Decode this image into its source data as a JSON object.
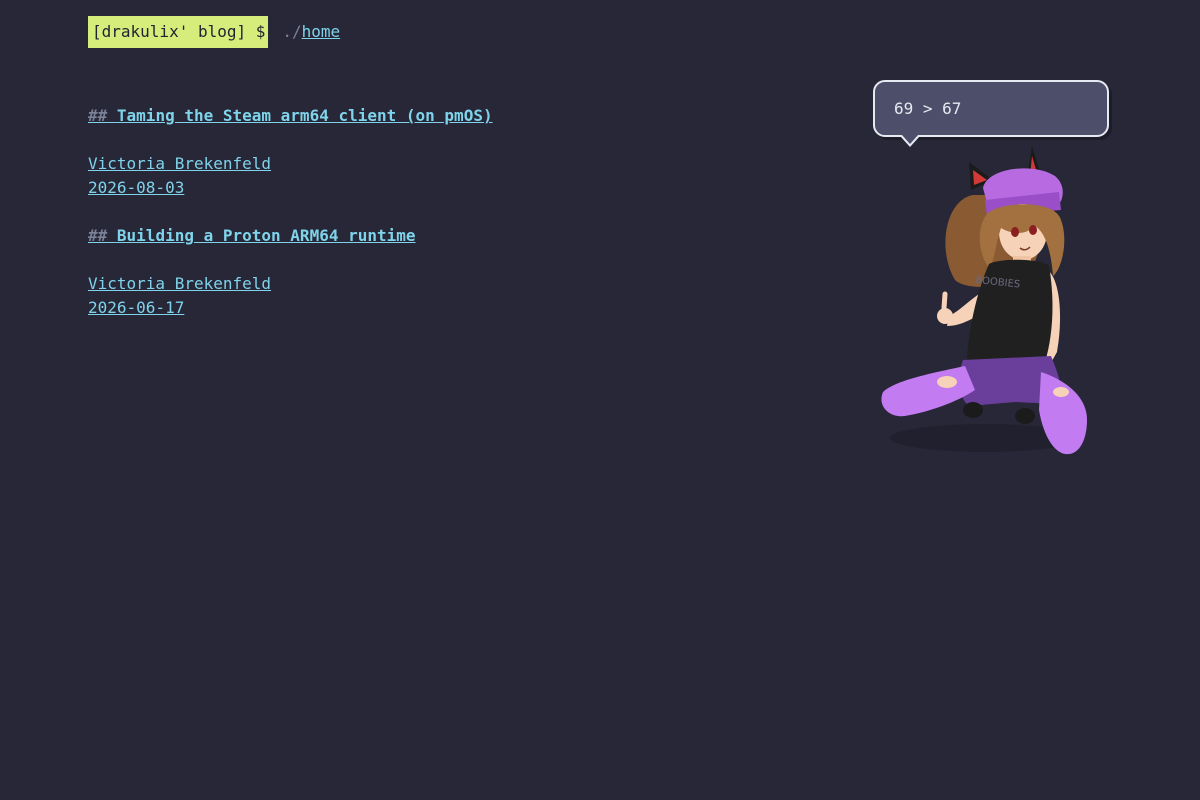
{
  "header": {
    "site_title": "[drakulix' blog] $",
    "breadcrumb_prefix": "./",
    "breadcrumb_link": "home"
  },
  "posts": [
    {
      "hash": "##",
      "title": "Taming the Steam arm64 client (on pmOS)",
      "author": "Victoria Brekenfeld",
      "date": "2026-08-03"
    },
    {
      "hash": "##",
      "title": "Building a Proton ARM64 runtime",
      "author": "Victoria Brekenfeld",
      "date": "2026-06-17"
    }
  ],
  "mascot": {
    "speech": "69 > 67",
    "shirt_text": "BOOBIES",
    "icon": "cat-girl-mascot"
  },
  "colors": {
    "background": "#272737",
    "title_badge": "#d6ed7c",
    "link": "#7fd3ea",
    "muted": "#7b8198",
    "bubble_bg": "#4d4e69",
    "accent_purple": "#b86be0"
  }
}
